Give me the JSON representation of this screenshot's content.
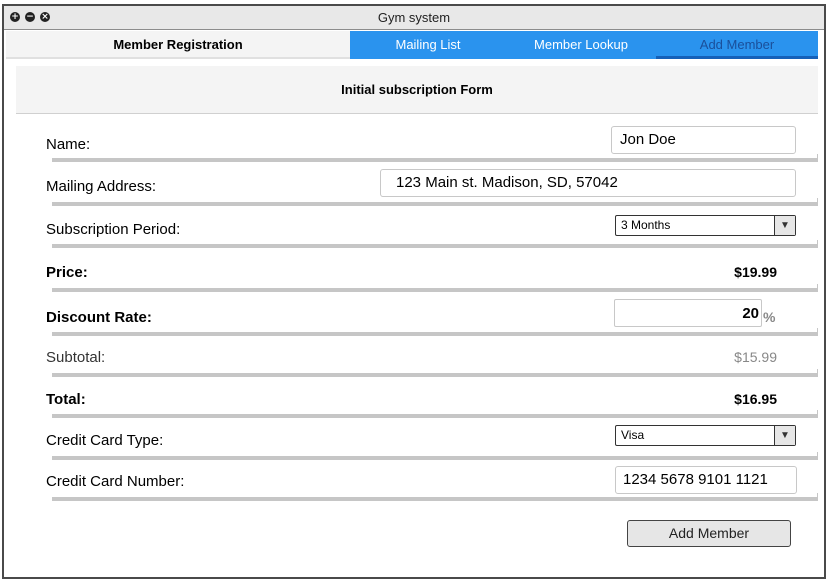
{
  "window": {
    "title": "Gym system"
  },
  "tabs": {
    "main": "Member Registration",
    "items": [
      "Mailing List",
      "Member Lookup",
      "Add Member"
    ]
  },
  "form": {
    "header": "Initial subscription Form",
    "name": {
      "label": "Name:",
      "value": "Jon Doe"
    },
    "address": {
      "label": "Mailing Address:",
      "value": "123 Main st. Madison, SD, 57042"
    },
    "period": {
      "label": "Subscription Period:",
      "value": "3 Months"
    },
    "price": {
      "label": "Price:",
      "value": "$19.99"
    },
    "discount": {
      "label": "Discount Rate:",
      "value": "20",
      "unit": "%"
    },
    "subtotal": {
      "label": "Subtotal:",
      "value": "$15.99"
    },
    "total": {
      "label": "Total:",
      "value": "$16.95"
    },
    "card_type": {
      "label": "Credit Card Type:",
      "value": "Visa"
    },
    "card_number": {
      "label": "Credit Card Number:",
      "value": "1234 5678 9101 1121"
    },
    "submit_label": "Add Member"
  },
  "colors": {
    "accent": "#2a93ee",
    "active_tab_border": "#1560b8"
  }
}
